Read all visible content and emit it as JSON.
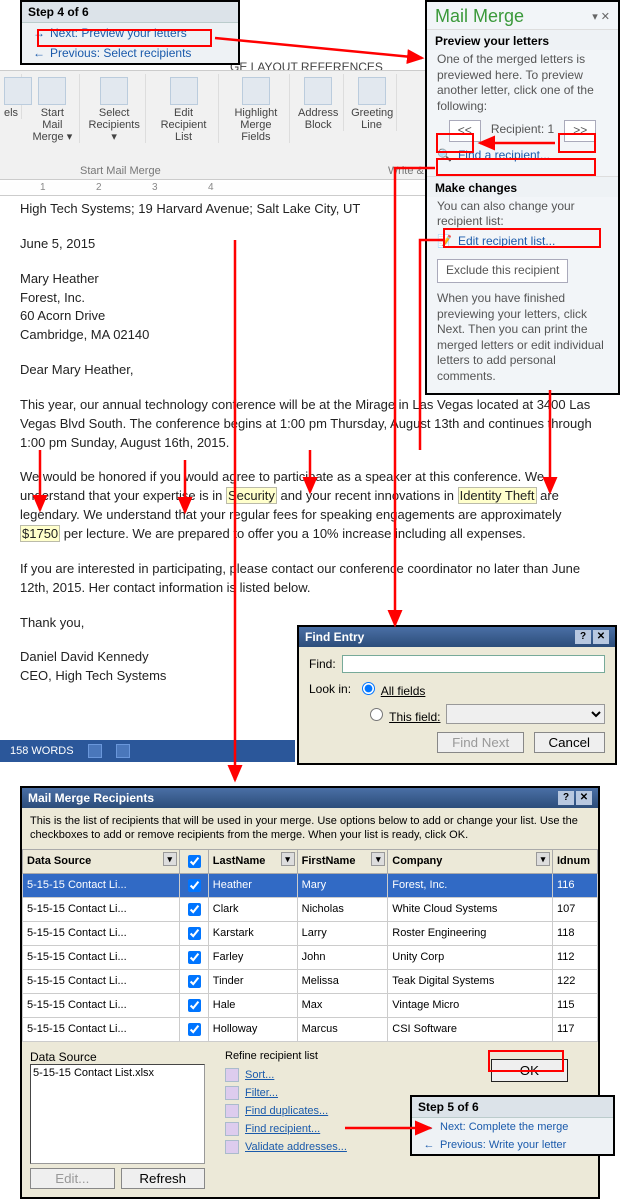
{
  "step4": {
    "title": "Step 4 of 6",
    "next": "Next: Preview your letters",
    "prev": "Previous: Select recipients"
  },
  "ribbon": {
    "tabs": "GE LAYOUT       REFERENCES",
    "items": [
      {
        "label": "els"
      },
      {
        "label": "Start Mail\nMerge ▾"
      },
      {
        "label": "Select\nRecipients ▾"
      },
      {
        "label": "Edit\nRecipient List"
      },
      {
        "label": "Highlight\nMerge Fields"
      },
      {
        "label": "Address\nBlock"
      },
      {
        "label": "Greeting\nLine"
      }
    ],
    "group1": "Start Mail Merge",
    "group2": "Write &"
  },
  "ruler": [
    "1",
    "2",
    "3",
    "4"
  ],
  "pane": {
    "title": "Mail Merge",
    "section1_title": "Preview your letters",
    "section1_body": "One of the merged letters is previewed here. To preview another letter, click one of the following:",
    "nav_prev": "<<",
    "nav_label": "Recipient: 1",
    "nav_next": ">>",
    "find": "Find a recipient...",
    "section2_title": "Make changes",
    "section2_body": "You can also change your recipient list:",
    "edit": "Edit recipient list...",
    "exclude": "Exclude this recipient",
    "section2_foot": "When you have finished previewing your letters, click Next. Then you can print the merged letters or edit individual letters to add personal comments."
  },
  "doc": {
    "header": "High Tech Systems; 19 Harvard Avenue; Salt Lake City, UT",
    "date": "June 5, 2015",
    "addr1": "Mary Heather",
    "addr2": "Forest, Inc.",
    "addr3": "60 Acorn Drive",
    "addr4": "Cambridge, MA 02140",
    "greeting": "Dear Mary Heather,",
    "p1": "This year, our annual technology conference will be at the Mirage in Las Vegas located at 3400 Las Vegas Blvd South. The conference begins at 1:00 pm Thursday, August 13th and continues through 1:00 pm Sunday, August 16th, 2015.",
    "p2a": "We would be honored if you would agree to participate as a speaker at this conference. We understand that your expertise is in ",
    "hl1": "Security",
    "p2b": " and your recent innovations in ",
    "hl2": "Identity Theft",
    "p2c": " are legendary. We understand that your regular fees for speaking engagements are approximately ",
    "hl3": "$1750",
    "p2d": " per lecture. We are prepared to offer you a 10% increase including all expenses.",
    "p3": "If you are interested in participating, please contact our conference coordinator no later than June 12th, 2015. Her contact information is listed below.",
    "thanks": "Thank you,",
    "sig1": "Daniel David Kennedy",
    "sig2": "CEO, High Tech Systems"
  },
  "statusbar": {
    "words": "158 WORDS"
  },
  "findEntry": {
    "title": "Find Entry",
    "find_lbl": "Find:",
    "lookin_lbl": "Look in:",
    "opt_all": "All fields",
    "opt_this": "This field:",
    "btn_find": "Find Next",
    "btn_cancel": "Cancel"
  },
  "recips": {
    "title": "Mail Merge Recipients",
    "intro": "This is the list of recipients that will be used in your merge. Use options below to add or change your list. Use the checkboxes to add or remove recipients from the merge.  When your list is ready, click OK.",
    "cols": [
      "Data Source",
      "",
      "LastName",
      "FirstName",
      "Company",
      "Idnum"
    ],
    "rows": [
      [
        "5-15-15 Contact Li...",
        "✓",
        "Heather",
        "Mary",
        "Forest, Inc.",
        "116"
      ],
      [
        "5-15-15 Contact Li...",
        "✓",
        "Clark",
        "Nicholas",
        "White Cloud Systems",
        "107"
      ],
      [
        "5-15-15 Contact Li...",
        "✓",
        "Karstark",
        "Larry",
        "Roster Engineering",
        "118"
      ],
      [
        "5-15-15 Contact Li...",
        "✓",
        "Farley",
        "John",
        "Unity Corp",
        "112"
      ],
      [
        "5-15-15 Contact Li...",
        "✓",
        "Tinder",
        "Melissa",
        "Teak Digital Systems",
        "122"
      ],
      [
        "5-15-15 Contact Li...",
        "✓",
        "Hale",
        "Max",
        "Vintage Micro",
        "115"
      ],
      [
        "5-15-15 Contact Li...",
        "✓",
        "Holloway",
        "Marcus",
        "CSI Software",
        "117"
      ]
    ],
    "ds_label": "Data Source",
    "ds_file": "5-15-15 Contact List.xlsx",
    "btn_edit": "Edit...",
    "btn_refresh": "Refresh",
    "refine_label": "Refine recipient list",
    "refine_links": [
      "Sort...",
      "Filter...",
      "Find duplicates...",
      "Find recipient...",
      "Validate addresses..."
    ],
    "ok": "OK"
  },
  "step5": {
    "title": "Step 5 of 6",
    "next": "Next: Complete the merge",
    "prev": "Previous: Write your letter"
  }
}
